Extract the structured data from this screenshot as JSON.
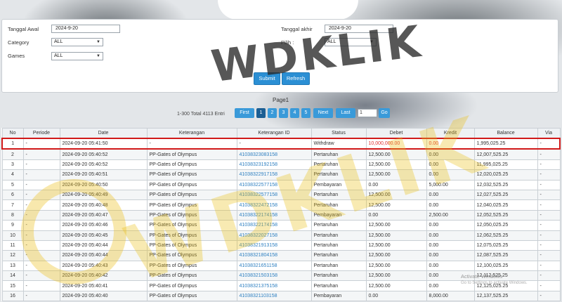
{
  "filters": {
    "tanggal_awal_label": "Tanggal Awal",
    "tanggal_awal_value": "2024-9-20",
    "tanggal_akhir_label": "Tanggal akhir",
    "tanggal_akhir_value": "2024-9-20",
    "category_label": "Category",
    "category_value": "ALL",
    "pilih_label": "Pilih  :",
    "pilih_value": "ALL",
    "games_label": "Games",
    "games_value": "ALL",
    "submit_label": "Submit",
    "refresh_label": "Refresh"
  },
  "pager": {
    "page_title": "Page1",
    "total_text": "1-300 Total 4113 Entri",
    "first": "First",
    "pages": [
      "1",
      "2",
      "3",
      "4",
      "5"
    ],
    "next": "Next",
    "last": "Last",
    "page_input": "1",
    "go": "Go"
  },
  "table": {
    "headers": [
      "No",
      "Periode",
      "Date",
      "Keterangan",
      "Keterangan ID",
      "Status",
      "Debet",
      "Kredit",
      "Balance",
      "Via"
    ],
    "rows": [
      [
        "1",
        "-",
        "2024-09-20 05:41:50",
        "-",
        "-",
        "Withdraw",
        "10,000,000.00",
        "0.00",
        "1,995,025.25",
        "-"
      ],
      [
        "2",
        "-",
        "2024-09-20 05:40:52",
        "PP-Gates of Olympus",
        "41038323083158",
        "Pertaruhan",
        "12,500.00",
        "0.00",
        "12,007,525.25",
        "-"
      ],
      [
        "3",
        "-",
        "2024-09-20 05:40:52",
        "PP-Gates of Olympus",
        "41038323192158",
        "Pertaruhan",
        "12,500.00",
        "0.00",
        "11,995,025.25",
        "-"
      ],
      [
        "4",
        "-",
        "2024-09-20 05:40:51",
        "PP-Gates of Olympus",
        "41038322917158",
        "Pertaruhan",
        "12,500.00",
        "0.00",
        "12,020,025.25",
        "-"
      ],
      [
        "5",
        "-",
        "2024-09-20 05:40:50",
        "PP-Gates of Olympus",
        "41038322577158",
        "Pembayaran",
        "0.00",
        "5,000.00",
        "12,032,525.25",
        "-"
      ],
      [
        "6",
        "-",
        "2024-09-20 05:40:49",
        "PP-Gates of Olympus",
        "41038322577158",
        "Pertaruhan",
        "12,500.00",
        "0.00",
        "12,027,525.25",
        "-"
      ],
      [
        "7",
        "-",
        "2024-09-20 05:40:48",
        "PP-Gates of Olympus",
        "41038322472158",
        "Pertaruhan",
        "12,500.00",
        "0.00",
        "12,040,025.25",
        "-"
      ],
      [
        "8",
        "-",
        "2024-09-20 05:40:47",
        "PP-Gates of Olympus",
        "41038322174158",
        "Pembayaran",
        "0.00",
        "2,500.00",
        "12,052,525.25",
        "-"
      ],
      [
        "9",
        "-",
        "2024-09-20 05:40:46",
        "PP-Gates of Olympus",
        "41038322174158",
        "Pertaruhan",
        "12,500.00",
        "0.00",
        "12,050,025.25",
        "-"
      ],
      [
        "10",
        "-",
        "2024-09-20 05:40:45",
        "PP-Gates of Olympus",
        "41038322027158",
        "Pertaruhan",
        "12,500.00",
        "0.00",
        "12,062,525.25",
        "-"
      ],
      [
        "11",
        "-",
        "2024-09-20 05:40:44",
        "PP-Gates of Olympus",
        "41038321913158",
        "Pertaruhan",
        "12,500.00",
        "0.00",
        "12,075,025.25",
        "-"
      ],
      [
        "12",
        "-",
        "2024-09-20 05:40:44",
        "PP-Gates of Olympus",
        "41038321804158",
        "Pertaruhan",
        "12,500.00",
        "0.00",
        "12,087,525.25",
        "-"
      ],
      [
        "13",
        "-",
        "2024-09-20 05:40:43",
        "PP-Gates of Olympus",
        "41038321651158",
        "Pertaruhan",
        "12,500.00",
        "0.00",
        "12,100,025.25",
        "-"
      ],
      [
        "14",
        "-",
        "2024-09-20 05:40:42",
        "PP-Gates of Olympus",
        "41038321503158",
        "Pertaruhan",
        "12,500.00",
        "0.00",
        "12,112,525.25",
        "-"
      ],
      [
        "15",
        "-",
        "2024-09-20 05:40:41",
        "PP-Gates of Olympus",
        "41038321375158",
        "Pertaruhan",
        "12,500.00",
        "0.00",
        "12,125,025.25",
        "-"
      ],
      [
        "16",
        "-",
        "2024-09-20 05:40:40",
        "PP-Gates of Olympus",
        "41038321103158",
        "Pembayaran",
        "0.00",
        "8,000.00",
        "12,137,525.25",
        "-"
      ]
    ]
  },
  "watermark": {
    "text": "WDKLIK",
    "activate_title": "Activate Windows",
    "activate_sub": "Go to Settings to activate Windows."
  },
  "colors": {
    "accent": "#2b8fd4",
    "highlight_border": "#d11a1a",
    "link": "#2d7fc1",
    "negative": "#e03030"
  }
}
